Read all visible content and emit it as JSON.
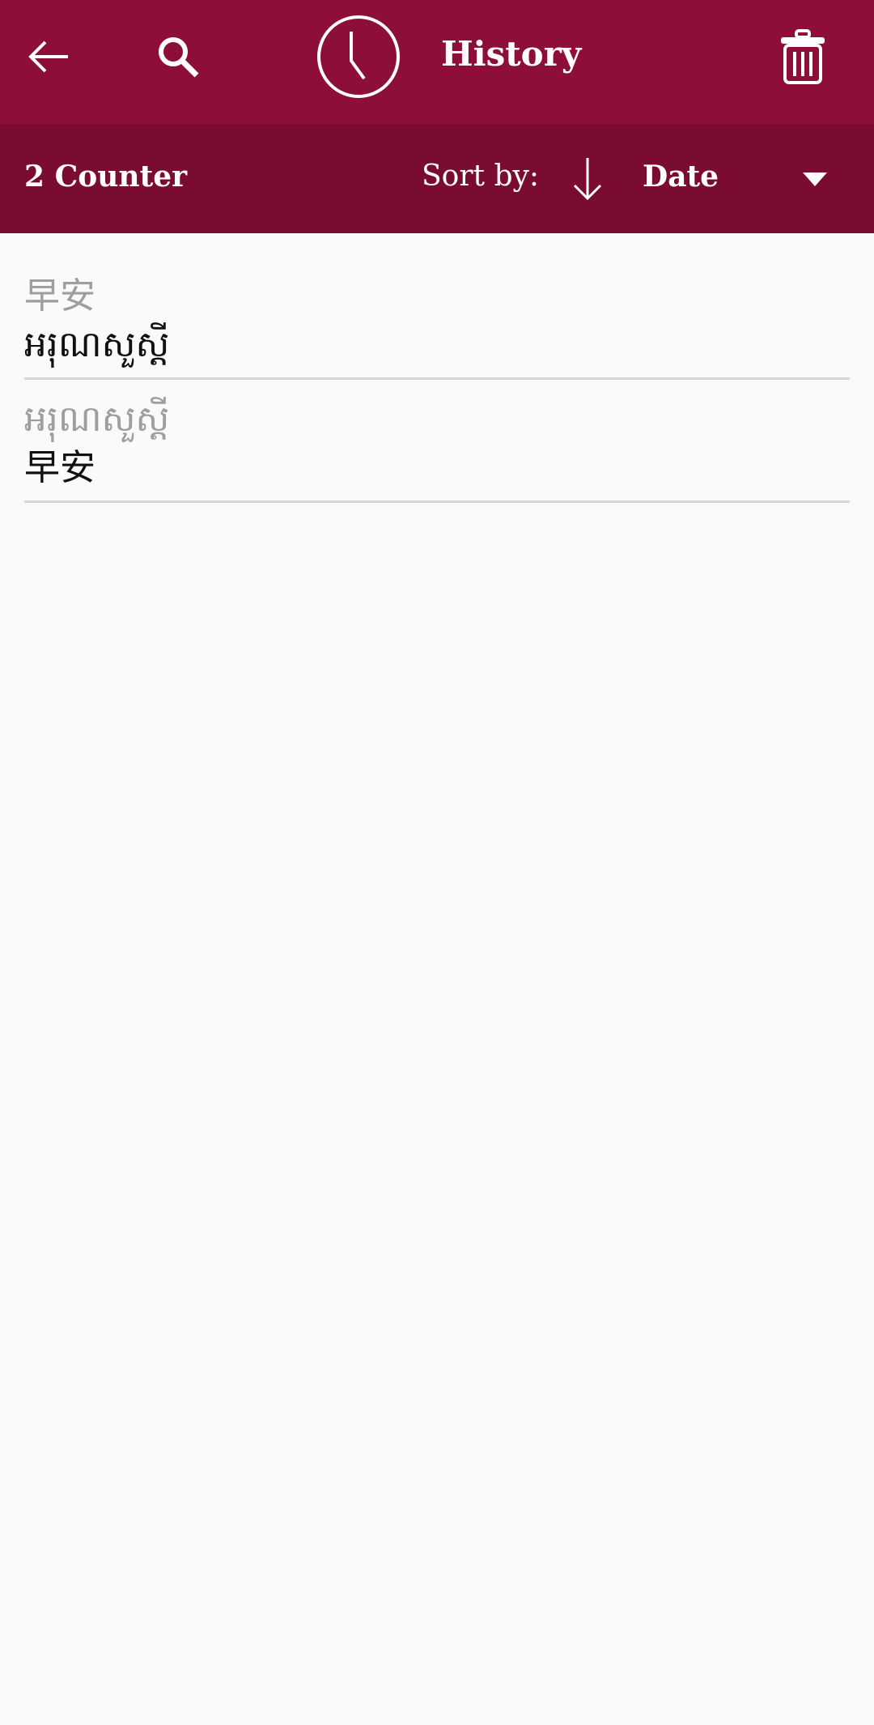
{
  "appbar": {
    "title": "History",
    "icons": [
      "back-arrow-icon",
      "search-icon",
      "clock-icon",
      "trash-icon"
    ],
    "color": "#8d0f37"
  },
  "subbar": {
    "counter": "2 Counter",
    "sort_label": "Sort by:",
    "sort_value": "Date",
    "sort_direction": "descending",
    "color": "#7a0c30"
  },
  "history": [
    {
      "source": "早安",
      "translation": "អរុណសួស្តី"
    },
    {
      "source": "អរុណសួស្តី",
      "translation": "早安"
    }
  ]
}
